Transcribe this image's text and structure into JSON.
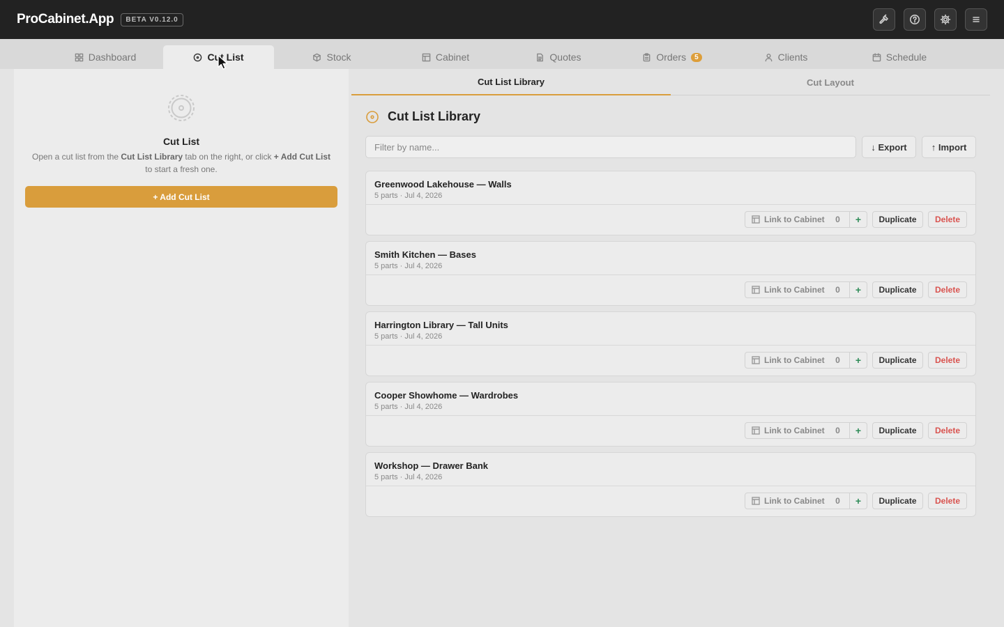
{
  "app": {
    "brand": "ProCabinet.App",
    "version_badge": "BETA V0.12.0"
  },
  "header_actions": [
    {
      "icon": "hammer-icon"
    },
    {
      "icon": "help-icon"
    },
    {
      "icon": "gear-icon"
    },
    {
      "icon": "menu-icon"
    }
  ],
  "tabs": [
    {
      "label": "Dashboard",
      "icon": "grid-icon"
    },
    {
      "label": "Cut List",
      "icon": "saw-icon",
      "active": true
    },
    {
      "label": "Stock",
      "icon": "box-icon"
    },
    {
      "label": "Cabinet",
      "icon": "cabinet-icon"
    },
    {
      "label": "Quotes",
      "icon": "document-icon"
    },
    {
      "label": "Orders",
      "icon": "clipboard-icon",
      "badge": "5"
    },
    {
      "label": "Clients",
      "icon": "user-icon"
    },
    {
      "label": "Schedule",
      "icon": "calendar-icon"
    }
  ],
  "left_panel": {
    "title": "Cut List",
    "desc_1": "Open a cut list from the ",
    "desc_strong_1": "Cut List Library",
    "desc_2": " tab on the right, or click ",
    "desc_strong_2": "+ Add Cut List",
    "desc_3": " to start a fresh one.",
    "add_button": "+ Add Cut List"
  },
  "subtabs": [
    {
      "label": "Cut List Library",
      "active": true
    },
    {
      "label": "Cut Layout"
    }
  ],
  "library": {
    "title": "Cut List Library",
    "filter_placeholder": "Filter by name...",
    "export_label": "↓ Export",
    "import_label": "↑ Import",
    "link_label": "Link to Cabinet",
    "duplicate_label": "Duplicate",
    "delete_label": "Delete",
    "items": [
      {
        "name": "Greenwood Lakehouse — Walls",
        "meta": "5 parts · Jul 4, 2026",
        "count": "0"
      },
      {
        "name": "Smith Kitchen — Bases",
        "meta": "5 parts · Jul 4, 2026",
        "count": "0"
      },
      {
        "name": "Harrington Library — Tall Units",
        "meta": "5 parts · Jul 4, 2026",
        "count": "0"
      },
      {
        "name": "Cooper Showhome — Wardrobes",
        "meta": "5 parts · Jul 4, 2026",
        "count": "0"
      },
      {
        "name": "Workshop — Drawer Bank",
        "meta": "5 parts · Jul 4, 2026",
        "count": "0"
      }
    ]
  },
  "colors": {
    "accent": "#d99d3c",
    "topbar": "#222222",
    "danger": "#d9534f",
    "plus": "#2e8b57"
  }
}
